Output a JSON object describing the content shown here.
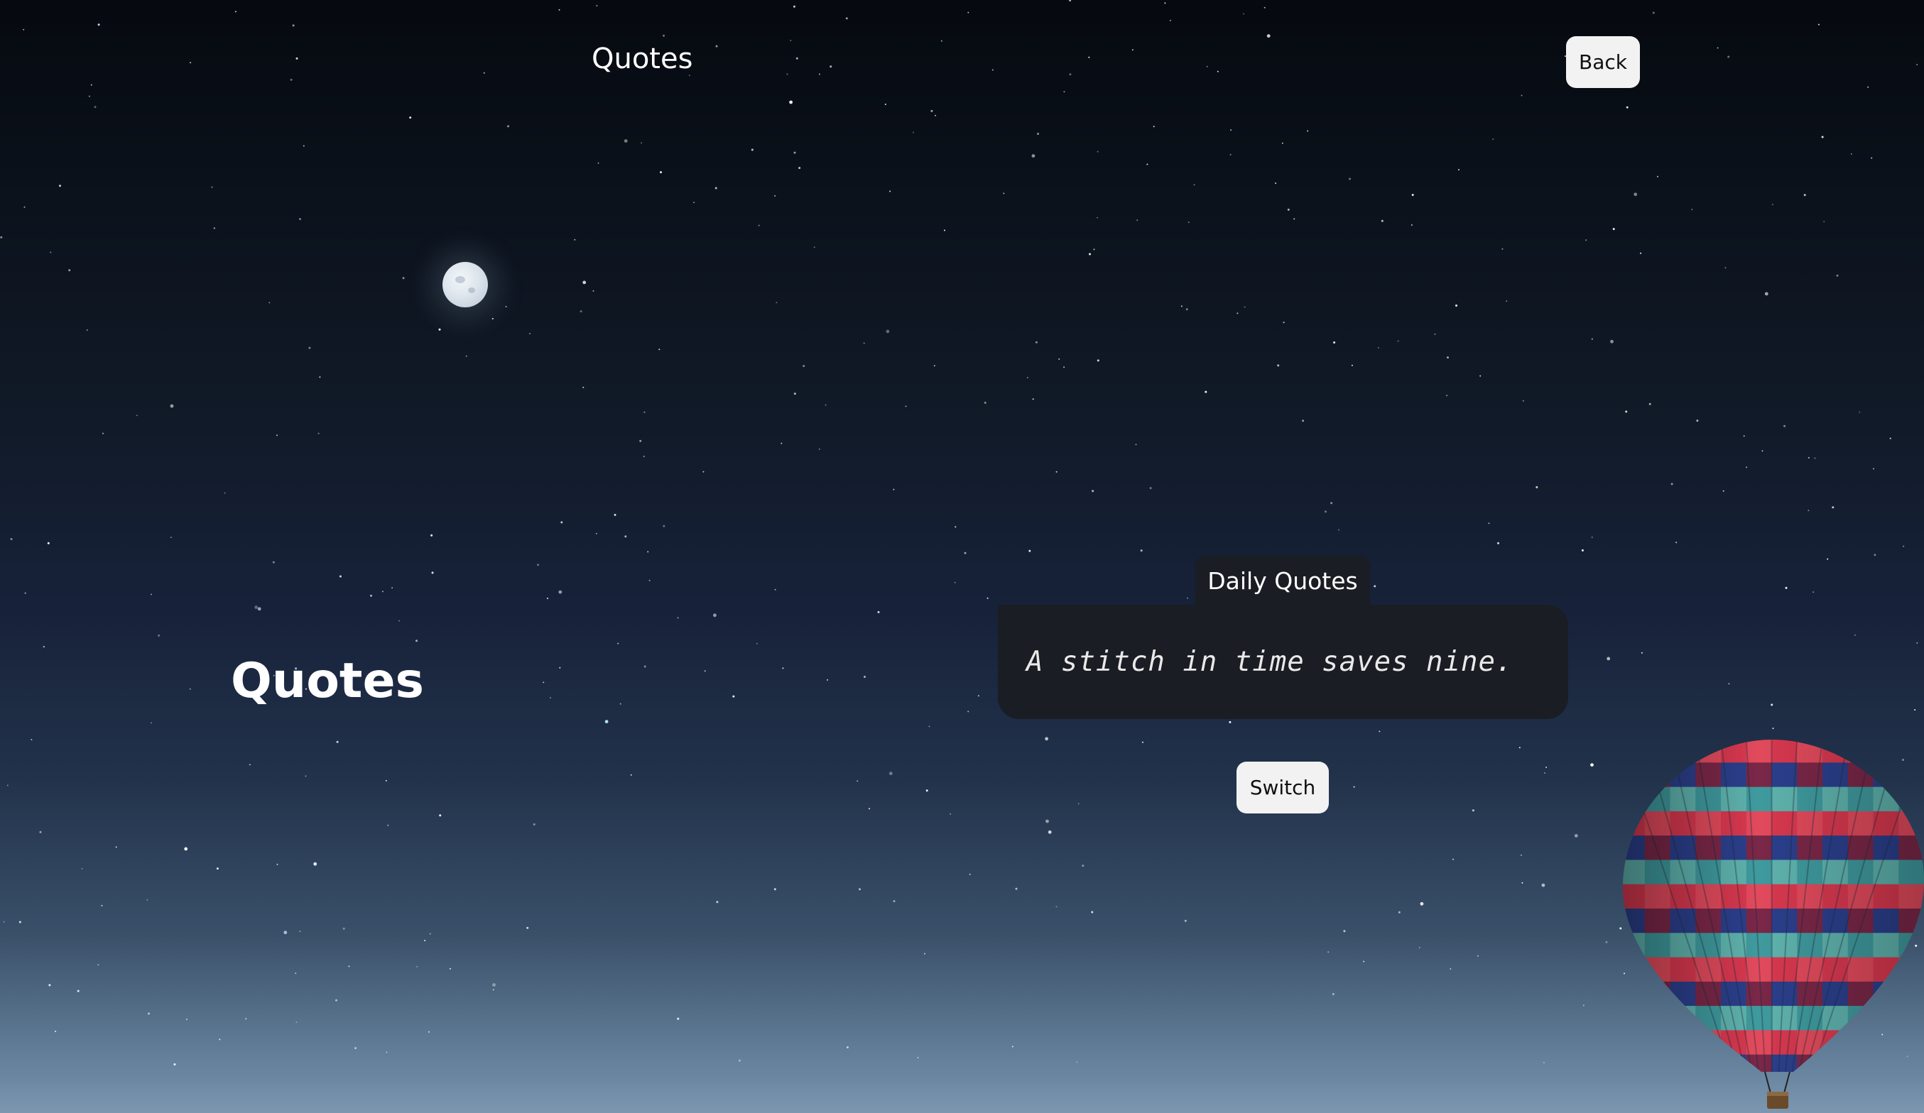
{
  "header": {
    "title": "Quotes",
    "back_label": "Back"
  },
  "hero": {
    "title": "Quotes"
  },
  "quote_panel": {
    "tab_label": "Daily Quotes",
    "quote": "A stitch in time saves nine.",
    "switch_label": "Switch"
  },
  "colors": {
    "card_background": "#1a1d23",
    "button_background": "#f2f2f2",
    "text_light": "#ffffff"
  }
}
